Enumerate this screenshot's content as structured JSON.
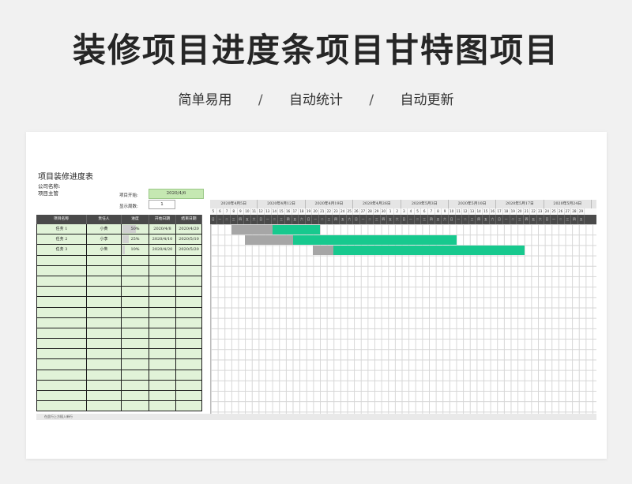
{
  "header": {
    "title": "装修项目进度条项目甘特图项目",
    "features": [
      "简单易用",
      "自动统计",
      "自动更新"
    ],
    "separator": "/"
  },
  "sheet": {
    "title": "项目装修进度表",
    "company_label": "公司名称:",
    "manager_label": "项目主管",
    "start_label": "项目开始:",
    "start_value": "2020/4/6",
    "weeks_label": "显示周数:",
    "weeks_value": "1",
    "footnote": "在此行上方插入新行"
  },
  "table": {
    "headers": [
      "项目名称",
      "责任人",
      "进度",
      "开始日期",
      "结束日期"
    ],
    "rows": [
      {
        "name": "任务 1",
        "owner": "小黄",
        "progress": "50%",
        "progress_value": 0.5,
        "start": "2020/4/8",
        "end": "2020/4/20"
      },
      {
        "name": "任务 2",
        "owner": "小李",
        "progress": "25%",
        "progress_value": 0.25,
        "start": "2020/4/10",
        "end": "2020/5/10"
      },
      {
        "name": "任务 3",
        "owner": "小朱",
        "progress": "10%",
        "progress_value": 0.1,
        "start": "2020/4/20",
        "end": "2020/5/20"
      }
    ],
    "empty_rows": 15
  },
  "gantt": {
    "weeks": [
      "2020年4月5日",
      "2020年4月12日",
      "2020年4月19日",
      "2020年4月26日",
      "2020年5月3日",
      "2020年5月10日",
      "2020年5月17日",
      "2020年5月24日"
    ],
    "days": [
      "5",
      "6",
      "7",
      "8",
      "9",
      "10",
      "11",
      "12",
      "13",
      "14",
      "15",
      "16",
      "17",
      "18",
      "19",
      "20",
      "21",
      "22",
      "23",
      "24",
      "25",
      "26",
      "27",
      "28",
      "29",
      "30",
      "1",
      "2",
      "3",
      "4",
      "5",
      "6",
      "7",
      "8",
      "9",
      "10",
      "11",
      "12",
      "13",
      "14",
      "15",
      "16",
      "17",
      "18",
      "19",
      "20",
      "21",
      "22",
      "23",
      "24",
      "25",
      "26",
      "27",
      "28",
      "29"
    ],
    "weekdays": [
      "日",
      "一",
      "二",
      "三",
      "四",
      "五",
      "六"
    ],
    "tasks": [
      {
        "done_start_day": 3,
        "done_days": 6,
        "todo_days": 7
      },
      {
        "done_start_day": 5,
        "done_days": 7,
        "todo_days": 24
      },
      {
        "done_start_day": 15,
        "done_days": 3,
        "todo_days": 28
      }
    ],
    "colors": {
      "done": "#a6a6a6",
      "todo": "#17c98e",
      "start_fill": "#c5e8b2"
    }
  }
}
